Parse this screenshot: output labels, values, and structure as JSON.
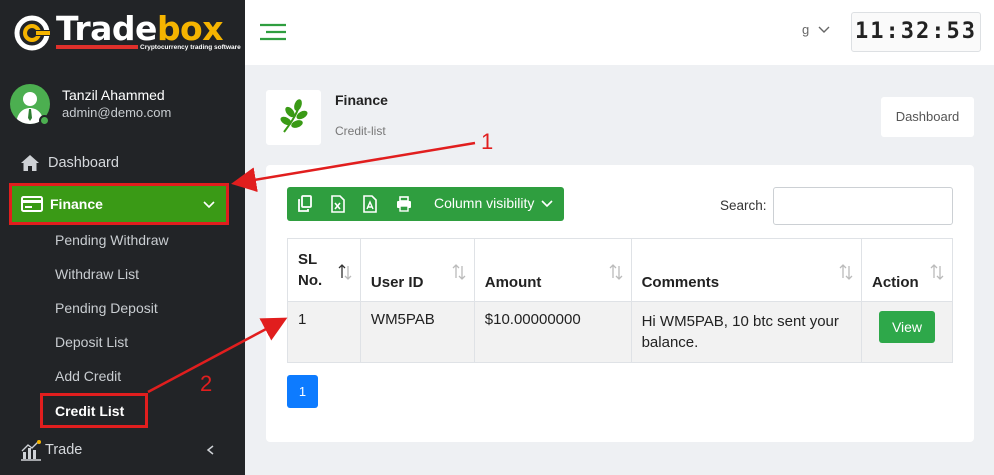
{
  "brand": {
    "name_part1": "Trade",
    "name_part2": "box",
    "tagline": "Cryptocurrency trading software"
  },
  "user": {
    "name": "Tanzil Ahammed",
    "email": "admin@demo.com"
  },
  "sidebar": {
    "dashboard": "Dashboard",
    "finance": "Finance",
    "finance_items": [
      "Pending Withdraw",
      "Withdraw List",
      "Pending Deposit",
      "Deposit List",
      "Add Credit",
      "Credit List"
    ],
    "trade": "Trade"
  },
  "topbar": {
    "lang_value": "g",
    "clock": "11:32:53"
  },
  "page": {
    "title": "Finance",
    "subtitle": "Credit-list",
    "breadcrumb": "Dashboard"
  },
  "toolbar": {
    "column_visibility": "Column visibility",
    "search_label": "Search:",
    "search_value": ""
  },
  "table": {
    "headers": [
      "SL No.",
      "User ID",
      "Amount",
      "Comments",
      "Action"
    ],
    "rows": [
      {
        "sl": "1",
        "user_id": "WM5PAB",
        "amount": "$10.00000000",
        "comments": "Hi WM5PAB, 10 btc sent your balance.",
        "action": "View"
      }
    ]
  },
  "pagination": {
    "current": "1"
  },
  "annotations": [
    "1",
    "2"
  ],
  "colors": {
    "sidebar_bg": "#222427",
    "active_green": "#3a9a16",
    "button_green": "#2f9e3f",
    "highlight_red": "#e11e1e",
    "page_blue": "#0d7bff"
  }
}
